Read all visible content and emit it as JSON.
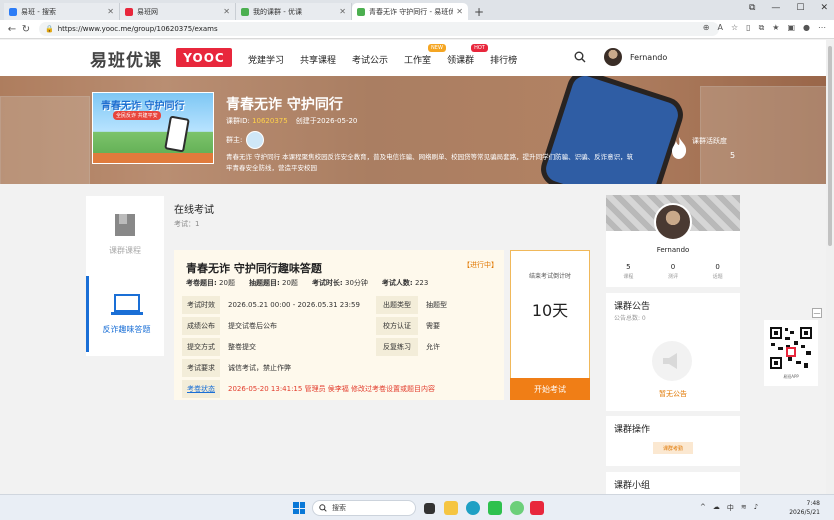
{
  "browser": {
    "tabs": [
      {
        "label": "易班 - 搜索",
        "icon_color": "#2d7cf6",
        "active": false
      },
      {
        "label": "易班网",
        "icon_color": "#e8273c",
        "active": false
      },
      {
        "label": "我的课群 - 优课",
        "icon_color": "#4caf50",
        "active": false
      },
      {
        "label": "青春无诈 守护同行 - 易班优课",
        "icon_color": "#4caf50",
        "active": true
      }
    ],
    "url": "https://www.yooc.me/group/10620375/exams"
  },
  "header": {
    "logo_text": "易班优课",
    "logo_badge": "YOOC",
    "nav": [
      {
        "label": "党建学习",
        "tag": ""
      },
      {
        "label": "共享课程",
        "tag": ""
      },
      {
        "label": "考试公示",
        "tag": ""
      },
      {
        "label": "工作室",
        "tag": "NEW",
        "tag_color": "#f5a623"
      },
      {
        "label": "领课群",
        "tag": "HOT",
        "tag_color": "#e8273c"
      },
      {
        "label": "排行榜",
        "tag": ""
      }
    ],
    "username": "Fernando"
  },
  "banner": {
    "cover_title": "青春无诈 守护同行",
    "cover_sub": "全民反诈 共建平安",
    "group_title": "青春无诈 守护同行",
    "group_id_label": "课群ID:",
    "group_id": "10620375",
    "created": "创建于2026-05-20",
    "owner_label": "群主:",
    "description": "青春无诈 守护同行 本课程聚焦校园反诈安全教育，普及电信诈骗、网络刷单、校园贷等常见骗局套路，提升同学们防骗、识骗、反诈意识，筑牢青春安全防线，营造平安校园",
    "activity_label": "课群活跃度",
    "activity_value": "5"
  },
  "sidenav": {
    "items": [
      {
        "label": "课群课程",
        "active": false
      },
      {
        "label": "反诈趣味答题",
        "active": true
      }
    ]
  },
  "exams": {
    "title": "在线考试",
    "count": "考试：1",
    "card": {
      "title": "青春无诈 守护同行趣味答题",
      "status": "【进行中】",
      "stats": [
        {
          "k": "考卷题目:",
          "v": "20题"
        },
        {
          "k": "抽题题目:",
          "v": "20题"
        },
        {
          "k": "考试时长:",
          "v": "30分钟"
        },
        {
          "k": "考试人数:",
          "v": "223"
        }
      ],
      "rows": [
        {
          "k": "考试时效",
          "v": "2026.05.21 00:00 - 2026.05.31 23:59",
          "k2": "出题类型",
          "v2": "抽题型"
        },
        {
          "k": "成绩公布",
          "v": "提交试卷后公布",
          "k2": "校方认证",
          "v2": "需要"
        },
        {
          "k": "提交方式",
          "v": "整卷提交",
          "k2": "反复练习",
          "v2": "允许"
        },
        {
          "k": "考试要求",
          "v": "诚信考试，禁止作弊",
          "k2": "",
          "v2": ""
        },
        {
          "k": "考卷状态",
          "v": "2026-05-20 13:41:15 管理员 侯李福 修改过考卷设置或题目内容",
          "k2": "",
          "v2": ""
        }
      ],
      "countdown_label": "结束考试倒计时",
      "countdown_value": "10天",
      "start_label": "开始考试"
    }
  },
  "profile": {
    "name": "Fernando",
    "stats": [
      {
        "value": "5",
        "label": "课程"
      },
      {
        "value": "0",
        "label": "测评"
      },
      {
        "value": "0",
        "label": "话题"
      }
    ]
  },
  "notice": {
    "title": "课群公告",
    "count": "公告总数:  0",
    "empty": "暂无公告"
  },
  "ops": {
    "title": "课群操作",
    "button": "课群考勤"
  },
  "groups": {
    "title": "课群小组"
  },
  "qr": {
    "label": "易班APP",
    "close": "—"
  },
  "taskbar": {
    "search": "搜索",
    "time": "7:48",
    "date": "2026/5/21",
    "ime": "中"
  }
}
